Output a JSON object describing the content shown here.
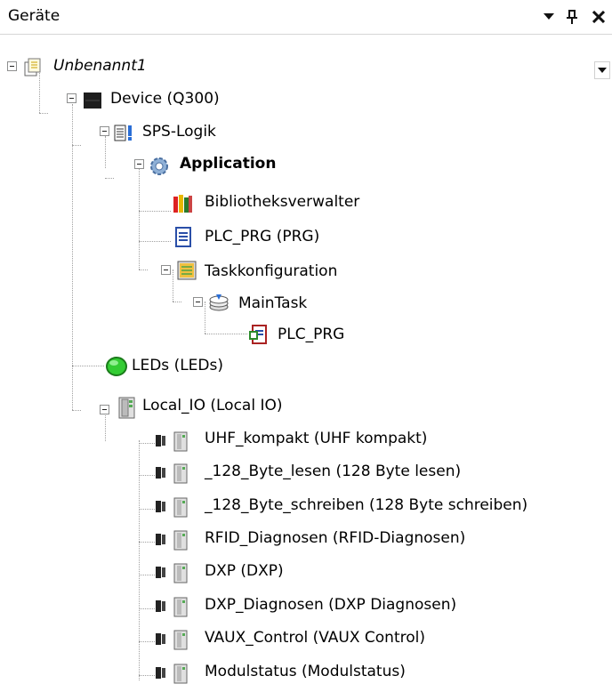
{
  "panel": {
    "title": "Geräte",
    "buttons": [
      {
        "name": "dropdown-arrow-icon"
      },
      {
        "name": "pin-icon"
      },
      {
        "name": "close-icon"
      }
    ]
  },
  "tree": {
    "items": [
      {
        "label": "Unbenannt1",
        "icon": "project-file-icon"
      },
      {
        "label": "Device (Q300)",
        "icon": "device-icon"
      },
      {
        "label": "SPS-Logik",
        "icon": "plc-logic-icon"
      },
      {
        "label": "Application",
        "icon": "application-gear-icon"
      },
      {
        "label": "Bibliotheksverwalter",
        "icon": "library-manager-icon"
      },
      {
        "label": "PLC_PRG (PRG)",
        "icon": "program-document-icon"
      },
      {
        "label": "Taskkonfiguration",
        "icon": "task-configuration-icon"
      },
      {
        "label": "MainTask",
        "icon": "main-task-icon"
      },
      {
        "label": "PLC_PRG",
        "icon": "program-call-icon"
      },
      {
        "label": "LEDs (LEDs)",
        "icon": "led-green-icon"
      },
      {
        "label": "Local_IO (Local IO)",
        "icon": "io-module-icon"
      },
      {
        "label": "UHF_kompakt (UHF kompakt)",
        "icon": "io-submodule-icon"
      },
      {
        "label": "_128_Byte_lesen (128 Byte lesen)",
        "icon": "io-submodule-icon"
      },
      {
        "label": "_128_Byte_schreiben (128 Byte schreiben)",
        "icon": "io-submodule-icon"
      },
      {
        "label": "RFID_Diagnosen (RFID-Diagnosen)",
        "icon": "io-submodule-icon"
      },
      {
        "label": "DXP (DXP)",
        "icon": "io-submodule-icon"
      },
      {
        "label": "DXP_Diagnosen (DXP Diagnosen)",
        "icon": "io-submodule-icon"
      },
      {
        "label": "VAUX_Control (VAUX Control)",
        "icon": "io-submodule-icon"
      },
      {
        "label": "Modulstatus (Modulstatus)",
        "icon": "io-submodule-icon"
      }
    ]
  },
  "colors": {
    "connector": "#a0a0a0",
    "led_green": "#33cc33",
    "device_dark": "#1e1e1e"
  }
}
